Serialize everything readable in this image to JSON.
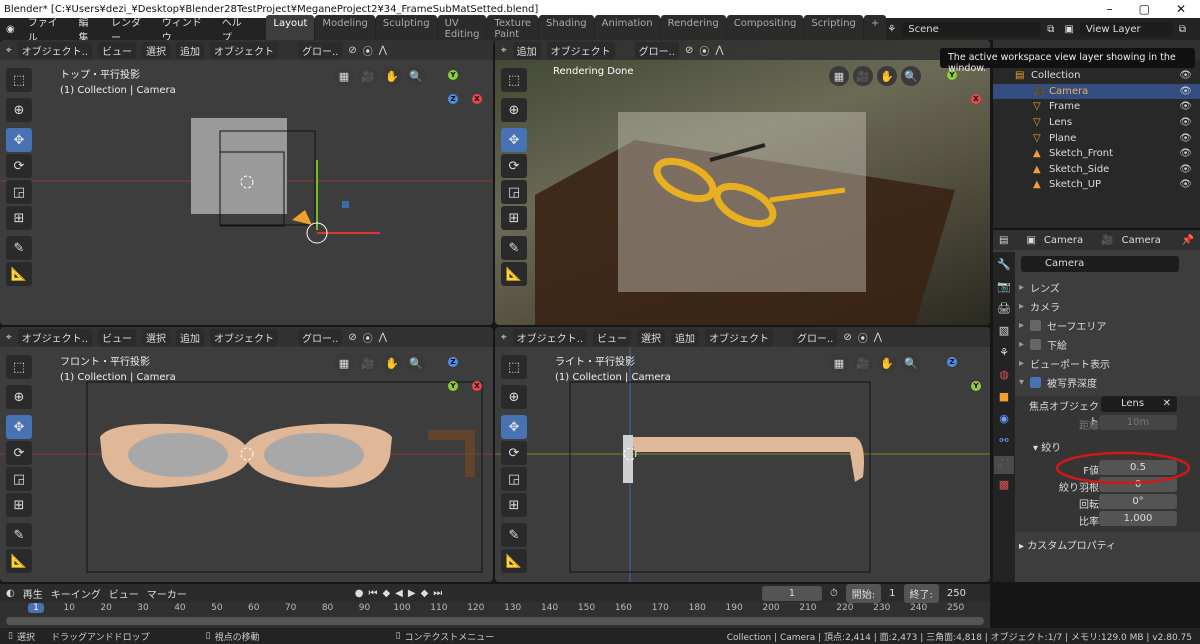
{
  "title": "Blender* [C:¥Users¥dezi_¥Desktop¥Blender28TestProject¥MeganeProject2¥34_FrameSubMatSetted.blend]",
  "menu": [
    "ファイル",
    "編集",
    "レンダー",
    "ウィンドウ",
    "ヘルプ"
  ],
  "workspaces": [
    "Layout",
    "Modeling",
    "Sculpting",
    "UV Editing",
    "Texture Paint",
    "Shading",
    "Animation",
    "Rendering",
    "Compositing",
    "Scripting",
    "+"
  ],
  "scene": "Scene",
  "view_layer": "View Layer",
  "tooltip": "The active workspace view layer showing in the window.",
  "vp_header": {
    "mode": "オブジェクト..",
    "view": "ビュー",
    "select": "選択",
    "add": "追加",
    "object": "オブジェクト",
    "orient": "グロー.."
  },
  "viewports": {
    "top_left": {
      "label": "トップ・平行投影",
      "sub": "(1) Collection | Camera"
    },
    "top_right": {
      "label": "Rendering Done"
    },
    "bottom_left": {
      "label": "フロント・平行投影",
      "sub": "(1) Collection | Camera"
    },
    "bottom_right": {
      "label": "ライト・平行投影",
      "sub": "(1) Collection | Camera"
    }
  },
  "axis_colors": {
    "x": "#e8464f",
    "y": "#8ecc3a",
    "z": "#4a8ee8"
  },
  "outliner": {
    "items": [
      {
        "name": "Collection",
        "icon": "collection-icon"
      },
      {
        "name": "Camera",
        "icon": "camera-icon",
        "selected": true
      },
      {
        "name": "Frame",
        "icon": "mesh-icon"
      },
      {
        "name": "Lens",
        "icon": "mesh-icon"
      },
      {
        "name": "Plane",
        "icon": "mesh-icon"
      },
      {
        "name": "Sketch_Front",
        "icon": "image-icon"
      },
      {
        "name": "Sketch_Side",
        "icon": "image-icon"
      },
      {
        "name": "Sketch_UP",
        "icon": "image-icon"
      }
    ]
  },
  "properties": {
    "obj": "Camera",
    "data": "Camera",
    "datablock": "Camera",
    "panels": [
      "レンズ",
      "カメラ",
      "セーフエリア",
      "下絵",
      "ビューポート表示",
      "被写界深度"
    ],
    "focus_label": "焦点オブジェクト",
    "focus_value": "Lens",
    "distance_label": "距離",
    "distance_value": "10m",
    "aperture": "絞り",
    "fstop_label": "F値",
    "fstop_value": "0.5",
    "blades_label": "絞り羽根",
    "blades_value": "0",
    "rotation_label": "回転",
    "rotation_value": "0°",
    "ratio_label": "比率",
    "ratio_value": "1.000",
    "custom": "カスタムプロパティ"
  },
  "timeline": {
    "menus": [
      "再生",
      "キーイング",
      "ビュー",
      "マーカー"
    ],
    "current": "1",
    "start_label": "開始:",
    "start": "1",
    "end_label": "終了:",
    "end": "250",
    "ticks": [
      "1",
      "10",
      "20",
      "30",
      "40",
      "50",
      "60",
      "70",
      "80",
      "90",
      "100",
      "110",
      "120",
      "130",
      "140",
      "150",
      "160",
      "170",
      "180",
      "190",
      "200",
      "210",
      "220",
      "230",
      "240",
      "250"
    ]
  },
  "status": {
    "select": "選択",
    "drag": "ドラッグアンドドロップ",
    "move": "視点の移動",
    "context": "コンテクストメニュー",
    "info": "Collection | Camera | 頂点:2,414 | 面:2,473 | 三角面:4,818 | オブジェクト:1/7 | メモリ:129.0 MB | v2.80.75"
  }
}
